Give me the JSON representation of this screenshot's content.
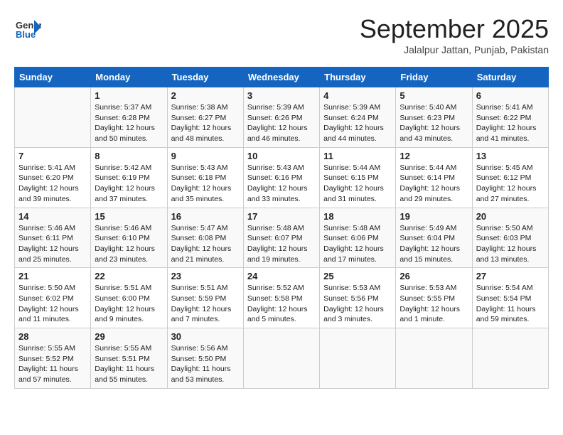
{
  "header": {
    "logo_line1": "General",
    "logo_line2": "Blue",
    "month_title": "September 2025",
    "subtitle": "Jalalpur Jattan, Punjab, Pakistan"
  },
  "days_of_week": [
    "Sunday",
    "Monday",
    "Tuesday",
    "Wednesday",
    "Thursday",
    "Friday",
    "Saturday"
  ],
  "weeks": [
    [
      {
        "day": "",
        "info": ""
      },
      {
        "day": "1",
        "info": "Sunrise: 5:37 AM\nSunset: 6:28 PM\nDaylight: 12 hours\nand 50 minutes."
      },
      {
        "day": "2",
        "info": "Sunrise: 5:38 AM\nSunset: 6:27 PM\nDaylight: 12 hours\nand 48 minutes."
      },
      {
        "day": "3",
        "info": "Sunrise: 5:39 AM\nSunset: 6:26 PM\nDaylight: 12 hours\nand 46 minutes."
      },
      {
        "day": "4",
        "info": "Sunrise: 5:39 AM\nSunset: 6:24 PM\nDaylight: 12 hours\nand 44 minutes."
      },
      {
        "day": "5",
        "info": "Sunrise: 5:40 AM\nSunset: 6:23 PM\nDaylight: 12 hours\nand 43 minutes."
      },
      {
        "day": "6",
        "info": "Sunrise: 5:41 AM\nSunset: 6:22 PM\nDaylight: 12 hours\nand 41 minutes."
      }
    ],
    [
      {
        "day": "7",
        "info": "Sunrise: 5:41 AM\nSunset: 6:20 PM\nDaylight: 12 hours\nand 39 minutes."
      },
      {
        "day": "8",
        "info": "Sunrise: 5:42 AM\nSunset: 6:19 PM\nDaylight: 12 hours\nand 37 minutes."
      },
      {
        "day": "9",
        "info": "Sunrise: 5:43 AM\nSunset: 6:18 PM\nDaylight: 12 hours\nand 35 minutes."
      },
      {
        "day": "10",
        "info": "Sunrise: 5:43 AM\nSunset: 6:16 PM\nDaylight: 12 hours\nand 33 minutes."
      },
      {
        "day": "11",
        "info": "Sunrise: 5:44 AM\nSunset: 6:15 PM\nDaylight: 12 hours\nand 31 minutes."
      },
      {
        "day": "12",
        "info": "Sunrise: 5:44 AM\nSunset: 6:14 PM\nDaylight: 12 hours\nand 29 minutes."
      },
      {
        "day": "13",
        "info": "Sunrise: 5:45 AM\nSunset: 6:12 PM\nDaylight: 12 hours\nand 27 minutes."
      }
    ],
    [
      {
        "day": "14",
        "info": "Sunrise: 5:46 AM\nSunset: 6:11 PM\nDaylight: 12 hours\nand 25 minutes."
      },
      {
        "day": "15",
        "info": "Sunrise: 5:46 AM\nSunset: 6:10 PM\nDaylight: 12 hours\nand 23 minutes."
      },
      {
        "day": "16",
        "info": "Sunrise: 5:47 AM\nSunset: 6:08 PM\nDaylight: 12 hours\nand 21 minutes."
      },
      {
        "day": "17",
        "info": "Sunrise: 5:48 AM\nSunset: 6:07 PM\nDaylight: 12 hours\nand 19 minutes."
      },
      {
        "day": "18",
        "info": "Sunrise: 5:48 AM\nSunset: 6:06 PM\nDaylight: 12 hours\nand 17 minutes."
      },
      {
        "day": "19",
        "info": "Sunrise: 5:49 AM\nSunset: 6:04 PM\nDaylight: 12 hours\nand 15 minutes."
      },
      {
        "day": "20",
        "info": "Sunrise: 5:50 AM\nSunset: 6:03 PM\nDaylight: 12 hours\nand 13 minutes."
      }
    ],
    [
      {
        "day": "21",
        "info": "Sunrise: 5:50 AM\nSunset: 6:02 PM\nDaylight: 12 hours\nand 11 minutes."
      },
      {
        "day": "22",
        "info": "Sunrise: 5:51 AM\nSunset: 6:00 PM\nDaylight: 12 hours\nand 9 minutes."
      },
      {
        "day": "23",
        "info": "Sunrise: 5:51 AM\nSunset: 5:59 PM\nDaylight: 12 hours\nand 7 minutes."
      },
      {
        "day": "24",
        "info": "Sunrise: 5:52 AM\nSunset: 5:58 PM\nDaylight: 12 hours\nand 5 minutes."
      },
      {
        "day": "25",
        "info": "Sunrise: 5:53 AM\nSunset: 5:56 PM\nDaylight: 12 hours\nand 3 minutes."
      },
      {
        "day": "26",
        "info": "Sunrise: 5:53 AM\nSunset: 5:55 PM\nDaylight: 12 hours\nand 1 minute."
      },
      {
        "day": "27",
        "info": "Sunrise: 5:54 AM\nSunset: 5:54 PM\nDaylight: 11 hours\nand 59 minutes."
      }
    ],
    [
      {
        "day": "28",
        "info": "Sunrise: 5:55 AM\nSunset: 5:52 PM\nDaylight: 11 hours\nand 57 minutes."
      },
      {
        "day": "29",
        "info": "Sunrise: 5:55 AM\nSunset: 5:51 PM\nDaylight: 11 hours\nand 55 minutes."
      },
      {
        "day": "30",
        "info": "Sunrise: 5:56 AM\nSunset: 5:50 PM\nDaylight: 11 hours\nand 53 minutes."
      },
      {
        "day": "",
        "info": ""
      },
      {
        "day": "",
        "info": ""
      },
      {
        "day": "",
        "info": ""
      },
      {
        "day": "",
        "info": ""
      }
    ]
  ]
}
